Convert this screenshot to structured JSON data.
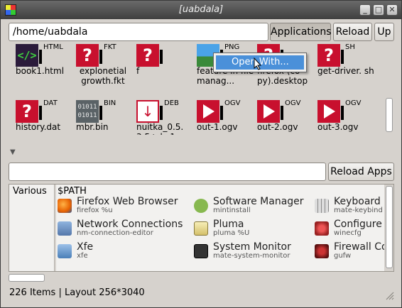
{
  "window": {
    "title": "[uabdala]",
    "buttons": [
      "_",
      "□",
      "✕"
    ]
  },
  "toolbar": {
    "path_value": "/home/uabdala",
    "applications_label": "Applications",
    "reload_label": "Reload",
    "up_label": "Up"
  },
  "files": [
    {
      "name": "book1.html",
      "type": "HTML",
      "icon": "html-file-icon"
    },
    {
      "name": "explonetial growth.fkt",
      "type": "FKT",
      "icon": "unknown-file-icon"
    },
    {
      "name": "f",
      "type": "",
      "icon": "unknown-file-icon"
    },
    {
      "name": "feature in file manag...",
      "type": "PNG",
      "icon": "image-file-icon"
    },
    {
      "name": "firefox (co py).desktop",
      "type": "",
      "icon": "unknown-file-icon"
    },
    {
      "name": "get-driver. sh",
      "type": "SH",
      "icon": "unknown-file-icon"
    },
    {
      "name": "history.dat",
      "type": "DAT",
      "icon": "unknown-file-icon"
    },
    {
      "name": "mbr.bin",
      "type": "BIN",
      "icon": "binary-file-icon"
    },
    {
      "name": "nuitka_0.5. 3.5+ds-1_a...",
      "type": "DEB",
      "icon": "debian-package-icon"
    },
    {
      "name": "out-1.ogv",
      "type": "OGV",
      "icon": "video-file-icon"
    },
    {
      "name": "out-2.ogv",
      "type": "OGV",
      "icon": "video-file-icon"
    },
    {
      "name": "out-3.ogv",
      "type": "OGV",
      "icon": "video-file-icon"
    }
  ],
  "context_menu": {
    "item_label": "Open With..."
  },
  "apps_filter": {
    "value": "",
    "reload_apps_label": "Reload Apps"
  },
  "apps": {
    "category_various": "Various",
    "category_path": "$PATH",
    "items": [
      {
        "name": "Firefox Web Browser",
        "cmd": "firefox %u",
        "icon": "firefox-icon",
        "color": "#e66000"
      },
      {
        "name": "Software Manager",
        "cmd": "mintinstall",
        "icon": "mint-icon",
        "color": "#87b84f"
      },
      {
        "name": "Keyboard",
        "cmd": "mate-keybind",
        "icon": "keyboard-icon",
        "color": "#9a9a9a"
      },
      {
        "name": "Network Connections",
        "cmd": "nm-connection-editor",
        "icon": "network-icon",
        "color": "#5577aa"
      },
      {
        "name": "Pluma",
        "cmd": "pluma %U",
        "icon": "pluma-icon",
        "color": "#d4c06a"
      },
      {
        "name": "Configure",
        "cmd": "winecfg",
        "icon": "wine-icon",
        "color": "#b33"
      },
      {
        "name": "Xfe",
        "cmd": "xfe",
        "icon": "xfe-icon",
        "color": "#4a7fb8"
      },
      {
        "name": "System Monitor",
        "cmd": "mate-system-monitor",
        "icon": "monitor-icon",
        "color": "#333"
      },
      {
        "name": "Firewall Co",
        "cmd": "gufw",
        "icon": "firewall-icon",
        "color": "#8b1a1a"
      }
    ]
  },
  "status": {
    "text": "226 Items | Layout 256*3040"
  }
}
